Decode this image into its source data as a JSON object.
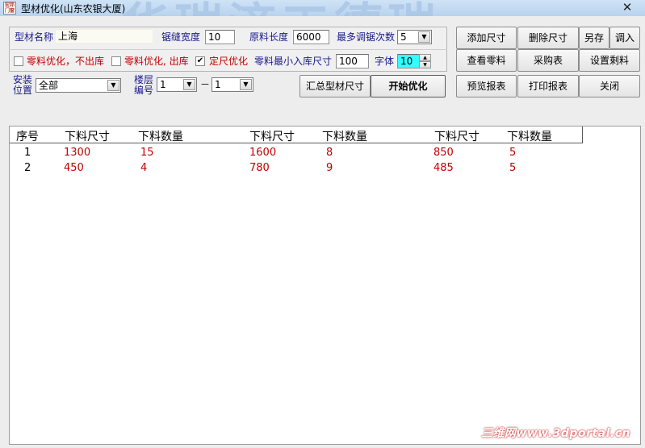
{
  "window": {
    "title": "型材优化(山东农银大厦)",
    "icon_text": "宏邦门窗",
    "watermark": "华瑞济工德瑞",
    "close": "✕"
  },
  "form": {
    "material_name_label": "型材名称",
    "material_name_value": "上海",
    "kerf_label": "锯缝宽度",
    "kerf_value": "10",
    "raw_length_label": "原料长度",
    "raw_length_value": "6000",
    "max_adjust_label": "最多调锯次数",
    "max_adjust_value": "5",
    "opt_scrap_no_store": "零料优化，不出库",
    "opt_scrap_store": "零料优化, 出库",
    "opt_fixed": "定尺优化",
    "opt_fixed_checked": "✔",
    "min_store_label": "零料最小入库尺寸",
    "min_store_value": "100",
    "font_label": "字体",
    "font_value": "10",
    "install_label_1": "安装",
    "install_label_2": "位置",
    "install_value": "全部",
    "floor_label_1": "楼层",
    "floor_label_2": "编号",
    "floor_from": "1",
    "floor_to": "1",
    "dash": "－",
    "dropdown_arrow": "▼",
    "spin_up": "▲",
    "spin_down": "▼"
  },
  "buttons": {
    "summary": "汇总型材尺寸",
    "optimize": "开始优化",
    "add_size": "添加尺寸",
    "delete_size": "删除尺寸",
    "save_as": "另存",
    "import": "调入",
    "view_scrap": "查看零料",
    "purchase": "采购表",
    "set_scrap": "设置剩料",
    "preview_report": "预览报表",
    "print_report": "打印报表",
    "close": "关闭"
  },
  "table": {
    "headers": [
      "序号",
      "下料尺寸",
      "下料数量",
      "下料尺寸",
      "下料数量",
      "下料尺寸",
      "下料数量"
    ],
    "rows": [
      [
        "1",
        "1300",
        "15",
        "1600",
        "8",
        "850",
        "5"
      ],
      [
        "2",
        "450",
        "4",
        "780",
        "9",
        "485",
        "5"
      ]
    ]
  },
  "footer": {
    "credit": "三维网www.3dportal.cn"
  },
  "colors": {
    "label_navy": "#1a1a8c",
    "option_red": "#c00000",
    "font_field_cyan": "#33ffff",
    "titlebar": "#b9d3ee"
  }
}
